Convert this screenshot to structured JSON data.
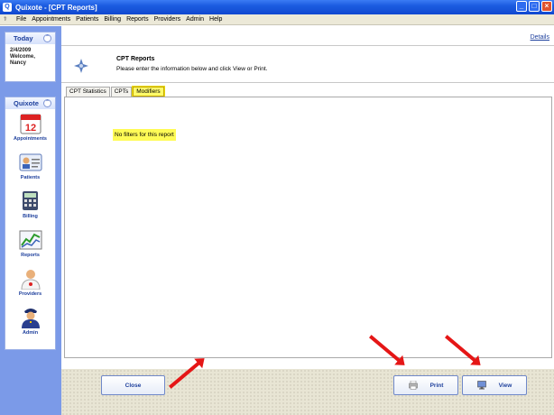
{
  "window": {
    "title": "Quixote - [CPT Reports]"
  },
  "menu": [
    "File",
    "Appointments",
    "Patients",
    "Billing",
    "Reports",
    "Providers",
    "Admin",
    "Help"
  ],
  "sidebar": {
    "today": {
      "title": "Today",
      "date": "2/4/2009",
      "welcome": "Welcome,",
      "user": "Nancy"
    },
    "quixote": {
      "title": "Quixote",
      "items": [
        {
          "label": "Appointments",
          "icon": "calendar-icon"
        },
        {
          "label": "Patients",
          "icon": "patient-card-icon"
        },
        {
          "label": "Billing",
          "icon": "calculator-icon"
        },
        {
          "label": "Reports",
          "icon": "chart-icon"
        },
        {
          "label": "Providers",
          "icon": "doctor-icon"
        },
        {
          "label": "Admin",
          "icon": "admin-officer-icon"
        }
      ]
    }
  },
  "main": {
    "details_link": "Details",
    "report_title": "CPT Reports",
    "report_desc": "Please enter the information below and click View or Print.",
    "tabs": [
      "CPT Statistics",
      "CPTs",
      "Modifiers"
    ],
    "active_tab": "Modifiers",
    "no_filter_text": "No filters for this report"
  },
  "buttons": {
    "close": "Close",
    "print": "Print",
    "view": "View"
  },
  "colors": {
    "title_bar": "#1c5ce0",
    "sidebar": "#7b9ae8",
    "highlight": "#fffb56",
    "arrow": "#e51616"
  }
}
